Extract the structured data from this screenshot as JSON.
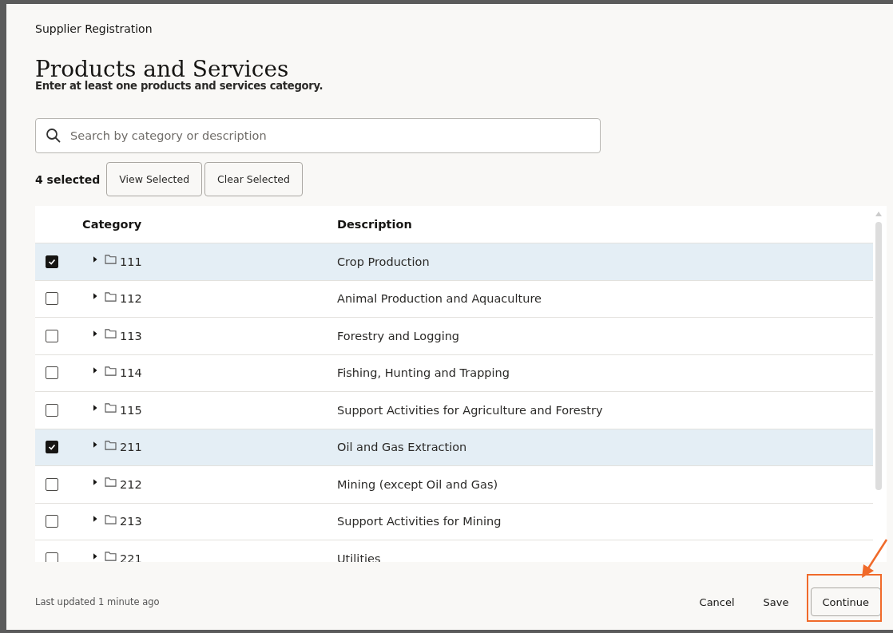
{
  "breadcrumb": "Supplier Registration",
  "title": "Products and Services",
  "subtitle": "Enter at least one products and services category.",
  "search": {
    "placeholder": "Search by category or description"
  },
  "selection": {
    "count": "4 selected",
    "buttons": [
      "View Selected",
      "Clear Selected"
    ]
  },
  "table": {
    "columns": [
      "Category",
      "Description"
    ],
    "rows": [
      {
        "category": "111",
        "description": "Crop Production",
        "checked": true,
        "expanded": false
      },
      {
        "category": "112",
        "description": "Animal Production and Aquaculture",
        "checked": false,
        "expanded": false
      },
      {
        "category": "113",
        "description": "Forestry and Logging",
        "checked": false,
        "expanded": false
      },
      {
        "category": "114",
        "description": "Fishing, Hunting and Trapping",
        "checked": false,
        "expanded": false
      },
      {
        "category": "115",
        "description": "Support Activities for Agriculture and Forestry",
        "checked": false,
        "expanded": false
      },
      {
        "category": "211",
        "description": "Oil and Gas Extraction",
        "checked": true,
        "expanded": false
      },
      {
        "category": "212",
        "description": "Mining (except Oil and Gas)",
        "checked": false,
        "expanded": false
      },
      {
        "category": "213",
        "description": "Support Activities for Mining",
        "checked": false,
        "expanded": false
      },
      {
        "category": "221",
        "description": "Utilities",
        "checked": false,
        "expanded": false
      }
    ]
  },
  "footer": {
    "status": "Last updated 1 minute ago",
    "actions": [
      {
        "label": "Cancel",
        "kind": "text"
      },
      {
        "label": "Save",
        "kind": "text"
      },
      {
        "label": "Continue",
        "kind": "outlined",
        "highlighted": true
      }
    ]
  }
}
